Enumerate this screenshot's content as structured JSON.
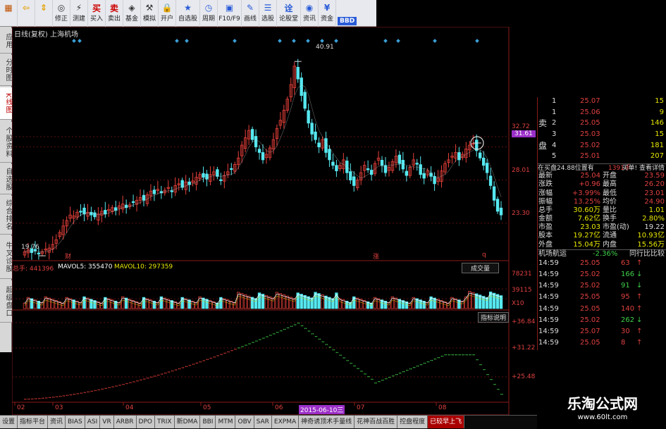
{
  "toolbar": {
    "buttons": [
      {
        "label": "",
        "icon": "grid-icon"
      },
      {
        "label": "",
        "icon": "back-arrow-icon"
      },
      {
        "label": "",
        "icon": "updown-arrow-icon"
      },
      {
        "label": "修正",
        "icon": "coins-icon"
      },
      {
        "label": "测建",
        "icon": "bolt-icon"
      },
      {
        "label": "买入",
        "icon": "buy-icon"
      },
      {
        "label": "卖出",
        "icon": "sell-icon"
      },
      {
        "label": "基金",
        "icon": "fund-icon"
      },
      {
        "label": "模拟",
        "icon": "hammer-icon"
      },
      {
        "label": "开户",
        "icon": "lock-icon"
      },
      {
        "label": "自选股",
        "icon": "star-icon"
      },
      {
        "label": "周期",
        "icon": "clock-icon"
      },
      {
        "label": "F10/F9",
        "icon": "f10-icon"
      },
      {
        "label": "画线",
        "icon": "pen-icon"
      },
      {
        "label": "选股",
        "icon": "select-icon"
      },
      {
        "label": "论股堂",
        "icon": "forum-icon"
      },
      {
        "label": "资讯",
        "icon": "news-icon"
      },
      {
        "label": "资金",
        "icon": "money-icon"
      }
    ],
    "bbd_label": "BBD"
  },
  "left_tabs": [
    "应用",
    "分时图",
    "K线图",
    "个股资料",
    "自选股",
    "综合排名",
    "牛叉诊股",
    "超级盘口"
  ],
  "chart": {
    "title": "日线(复权)  上海机场",
    "price_axis": [
      "32.72",
      "31.61",
      "28.01",
      "23.30"
    ],
    "high_label": "40.91",
    "low_label": "19.76",
    "markers": [
      "财",
      "涨",
      "q"
    ],
    "volume_header": {
      "label": "总手: 441396",
      "mavol5": "MAVOL5: 355470",
      "mavol10": "MAVOL10: 297359"
    },
    "volume_axis": [
      "78231",
      "39115",
      "X10"
    ],
    "volume_button": "成交量",
    "indicator_button": "指标说明",
    "indicator_axis": [
      "+36.84",
      "+31.22",
      "+25.48"
    ],
    "date_axis": [
      "02",
      "03",
      "04",
      "05",
      "06",
      "07",
      "08"
    ],
    "date_highlight": "2015-06-10三",
    "colors": {
      "up": "#e8403a",
      "down": "#56e8f0",
      "ma": "#ffffff",
      "highlight": "#9b2fc8"
    }
  },
  "order_book": {
    "sell_label": "卖盘",
    "rows": [
      {
        "n": "1",
        "price": "25.07",
        "vol": "15"
      },
      {
        "n": "1",
        "price": "25.06",
        "vol": "9"
      },
      {
        "n": "2",
        "price": "25.05",
        "vol": "146"
      },
      {
        "n": "3",
        "price": "25.03",
        "vol": "15"
      },
      {
        "n": "4",
        "price": "25.02",
        "vol": "181"
      },
      {
        "n": "5",
        "price": "25.01",
        "vol": "207"
      }
    ],
    "notice_left": "在买盘24.88位置有",
    "notice_mid": "1391手",
    "notice_right": "买单! 查看详情"
  },
  "quote": [
    {
      "k1": "最新",
      "v1": "25.04",
      "k2": "开盘",
      "v2": "23.59"
    },
    {
      "k1": "涨跌",
      "v1": "+0.96",
      "k2": "最高",
      "v2": "26.20"
    },
    {
      "k1": "涨幅",
      "v1": "+3.99%",
      "k2": "最低",
      "v2": "23.01"
    },
    {
      "k1": "振幅",
      "v1": "13.25%",
      "k2": "均价",
      "v2": "24.90"
    },
    {
      "k1": "总手",
      "v1": "30.60万",
      "k2": "量比",
      "v2": "1.01"
    },
    {
      "k1": "金额",
      "v1": "7.62亿",
      "k2": "换手",
      "v2": "2.80%"
    },
    {
      "k1": "市盈",
      "v1": "23.03",
      "k2": "市盈(动)",
      "v2": "19.22"
    },
    {
      "k1": "股本",
      "v1": "19.27亿",
      "k2": "流通",
      "v2": "10.93亿"
    },
    {
      "k1": "外盘",
      "v1": "15.04万",
      "k2": "内盘",
      "v2": "15.56万"
    }
  ],
  "sector": {
    "name": "机场航运",
    "change": "-2.36%",
    "link": "同行比比较"
  },
  "ticks": [
    {
      "t": "14:59",
      "p": "25.05",
      "v": "63",
      "d": "up"
    },
    {
      "t": "14:59",
      "p": "25.02",
      "v": "166",
      "d": "down"
    },
    {
      "t": "14:59",
      "p": "25.02",
      "v": "91",
      "d": "down"
    },
    {
      "t": "14:59",
      "p": "25.05",
      "v": "95",
      "d": "up"
    },
    {
      "t": "14:59",
      "p": "25.05",
      "v": "140",
      "d": "up"
    },
    {
      "t": "14:59",
      "p": "25.02",
      "v": "262",
      "d": "down"
    },
    {
      "t": "14:59",
      "p": "25.07",
      "v": "30",
      "d": "up"
    },
    {
      "t": "14:59",
      "p": "25.05",
      "v": "8",
      "d": "up"
    }
  ],
  "bottom_tabs": [
    "设置",
    "指标平台",
    "资讯",
    "BIAS",
    "ASI",
    "VR",
    "ARBR",
    "DPO",
    "TRIX",
    "新DMA",
    "BBI",
    "MTM",
    "OBV",
    "SAR",
    "EXPMA",
    "神奇诱顶术手量线",
    "花神百战百胜",
    "控盘程度",
    "已较早上飞"
  ],
  "watermark": {
    "text": "乐淘公式网",
    "url": "www.60lt.com"
  },
  "chart_data": {
    "type": "candlestick",
    "title": "日线(复权)  上海机场",
    "x_labels": [
      "02",
      "03",
      "04",
      "05",
      "06",
      "07",
      "08"
    ],
    "ylim": [
      19.0,
      42.0
    ],
    "price_ticks": [
      32.72,
      31.61,
      28.01,
      23.3
    ],
    "high": 40.91,
    "low": 19.76,
    "close_path": [
      20.2,
      20.4,
      20.1,
      20.3,
      20.0,
      20.2,
      20.5,
      20.6,
      21.0,
      21.5,
      22.3,
      23.0,
      23.6,
      24.2,
      24.1,
      24.5,
      24.6,
      24.3,
      24.5,
      24.2,
      24.0,
      24.3,
      24.6,
      24.3,
      24.8,
      25.0,
      24.7,
      25.2,
      25.4,
      25.0,
      25.3,
      25.6,
      25.8,
      26.1,
      25.8,
      26.4,
      26.8,
      26.5,
      27.0,
      26.6,
      26.9,
      27.2,
      26.8,
      27.4,
      27.6,
      27.2,
      27.8,
      27.5,
      27.9,
      28.3,
      28.6,
      28.3,
      28.1,
      28.6,
      28.9,
      28.4,
      28.0,
      28.5,
      28.9,
      29.2,
      29.7,
      30.4,
      31.8,
      32.6,
      33.4,
      32.4,
      31.6,
      31.0,
      30.2,
      30.8,
      31.5,
      32.4,
      33.6,
      34.5,
      35.6,
      36.8,
      38.4,
      40.4,
      39.0,
      37.2,
      35.8,
      34.2,
      33.0,
      32.4,
      31.6,
      32.4,
      31.0,
      30.2,
      29.6,
      29.0,
      29.6,
      30.2,
      28.8,
      28.0,
      27.4,
      28.0,
      28.8,
      29.6,
      29.2,
      28.6,
      29.8,
      30.4,
      29.6,
      28.8,
      29.4,
      30.0,
      30.6,
      29.8,
      29.2,
      28.5,
      29.4,
      30.2,
      29.8,
      28.6,
      28.2,
      29.0,
      28.4,
      27.6,
      28.2,
      29.0,
      29.8,
      30.2,
      30.6,
      31.0,
      30.2,
      30.8,
      31.4,
      31.8,
      32.0,
      31.2,
      30.4,
      29.6,
      28.8,
      27.4,
      25.8,
      24.6,
      24.2
    ],
    "volume_ylim": [
      0,
      90000
    ],
    "volume_ticks": [
      78231,
      39115
    ],
    "volume_total": 441396,
    "mavol5": 355470,
    "mavol10": 297359,
    "indicator_ticks": [
      36.84,
      31.22,
      25.48
    ]
  }
}
